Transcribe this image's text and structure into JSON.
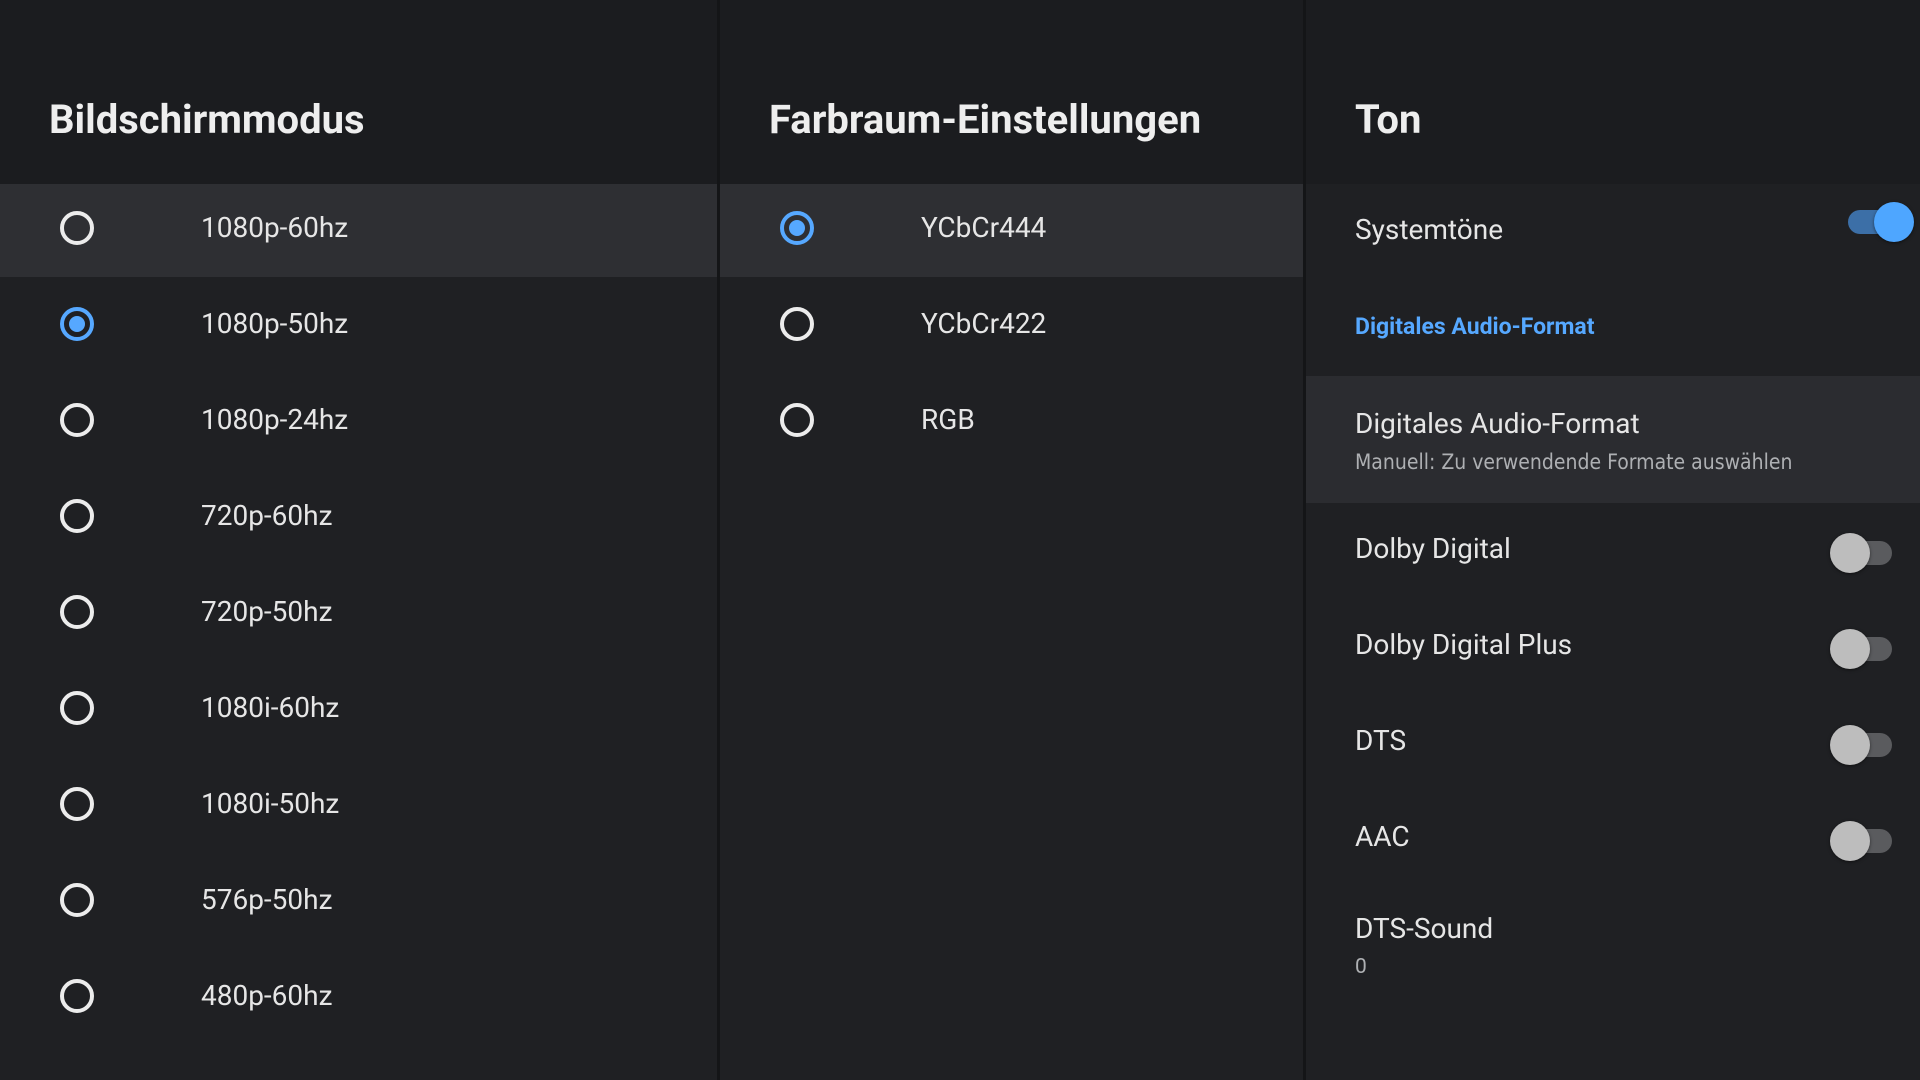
{
  "display_mode": {
    "title": "Bildschirmmodus",
    "options": [
      {
        "label": "1080p-60hz",
        "checked": false,
        "focused": true
      },
      {
        "label": "1080p-50hz",
        "checked": true,
        "focused": false
      },
      {
        "label": "1080p-24hz",
        "checked": false,
        "focused": false
      },
      {
        "label": "720p-60hz",
        "checked": false,
        "focused": false
      },
      {
        "label": "720p-50hz",
        "checked": false,
        "focused": false
      },
      {
        "label": "1080i-60hz",
        "checked": false,
        "focused": false
      },
      {
        "label": "1080i-50hz",
        "checked": false,
        "focused": false
      },
      {
        "label": "576p-50hz",
        "checked": false,
        "focused": false
      },
      {
        "label": "480p-60hz",
        "checked": false,
        "focused": false
      }
    ]
  },
  "color_space": {
    "title": "Farbraum-Einstellungen",
    "options": [
      {
        "label": "YCbCr444",
        "checked": true,
        "focused": true
      },
      {
        "label": "YCbCr422",
        "checked": false,
        "focused": false
      },
      {
        "label": "RGB",
        "checked": false,
        "focused": false
      }
    ]
  },
  "sound": {
    "title": "Ton",
    "system_sounds": {
      "label": "Systemtöne",
      "on": true
    },
    "section_label": "Digitales Audio-Format",
    "audio_format": {
      "title": "Digitales Audio-Format",
      "summary": "Manuell: Zu verwendende Formate auswählen"
    },
    "formats": [
      {
        "label": "Dolby Digital",
        "on": false
      },
      {
        "label": "Dolby Digital Plus",
        "on": false
      },
      {
        "label": "DTS",
        "on": false
      },
      {
        "label": "AAC",
        "on": false
      }
    ],
    "dts_sound": {
      "title": "DTS-Sound",
      "value": "0"
    }
  },
  "colors": {
    "accent": "#56a8ff",
    "panel": "#1f2023",
    "focused_row": "#2e2f33"
  }
}
